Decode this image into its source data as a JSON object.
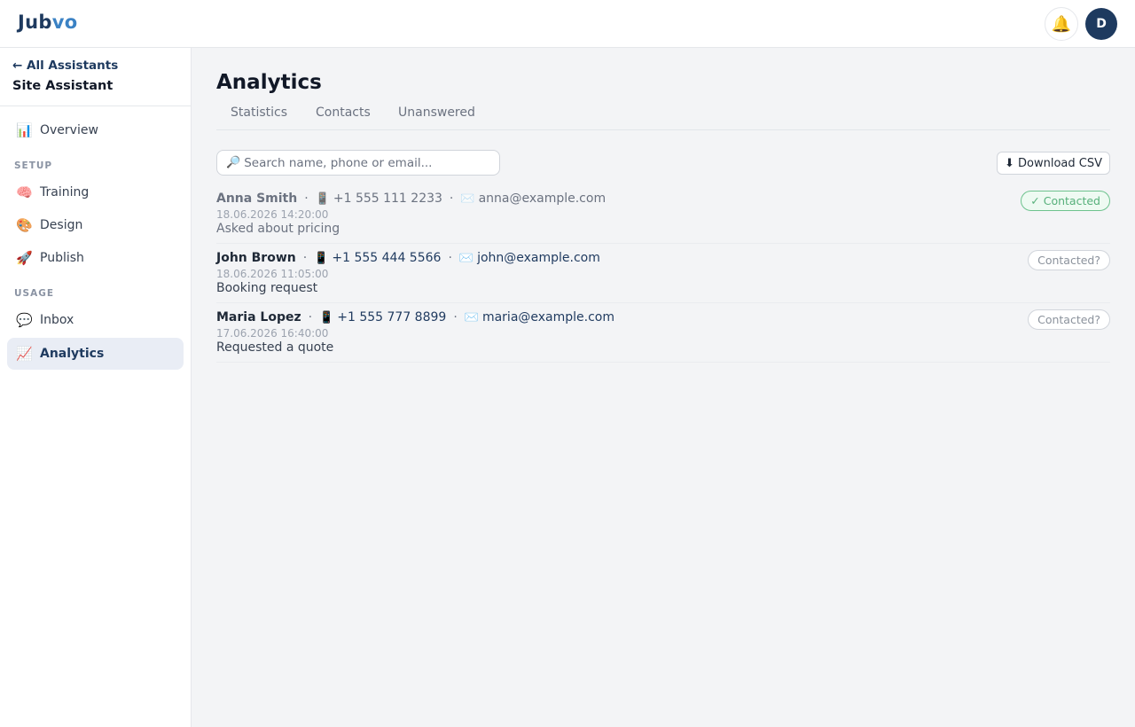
{
  "header": {
    "logo_part1": "Jub",
    "logo_part2": "vo",
    "notification_icon": "bell-icon",
    "avatar_initial": "D"
  },
  "sidebar": {
    "back_label": "← All Assistants",
    "assistant_name": "Site Assistant",
    "items": [
      {
        "label": "Overview",
        "icon": "📊"
      },
      {
        "label": "Training",
        "icon": "🧠"
      },
      {
        "label": "Design",
        "icon": "🎨"
      },
      {
        "label": "Publish",
        "icon": "🚀"
      },
      {
        "label": "Inbox",
        "icon": "💬"
      },
      {
        "label": "Analytics",
        "icon": "📈",
        "active": true
      }
    ],
    "sections": {
      "setup": "SETUP",
      "usage": "USAGE"
    }
  },
  "main": {
    "title": "Analytics",
    "tabs": [
      "Statistics",
      "Contacts",
      "Unanswered"
    ],
    "search_placeholder": "Search name, phone or email...",
    "download_label": "⬇ Download CSV",
    "contacts": [
      {
        "name": "Anna Smith",
        "phone": "+1 555 111 2233",
        "email": "anna@example.com",
        "date": "18.06.2026 14:20:00",
        "note": "Asked about pricing",
        "status": "✓ Contacted",
        "contacted": true
      },
      {
        "name": "John Brown",
        "phone": "+1 555 444 5566",
        "email": "john@example.com",
        "date": "18.06.2026 11:05:00",
        "note": "Booking request",
        "status": "Contacted?",
        "contacted": false
      },
      {
        "name": "Maria Lopez",
        "phone": "+1 555 777 8899",
        "email": "maria@example.com",
        "date": "17.06.2026 16:40:00",
        "note": "Requested a quote",
        "status": "Contacted?",
        "contacted": false
      }
    ]
  },
  "colors": {
    "brand_dark": "#1e3a5f",
    "brand_light": "#3b82c4",
    "contacted_green": "#56b07a"
  }
}
